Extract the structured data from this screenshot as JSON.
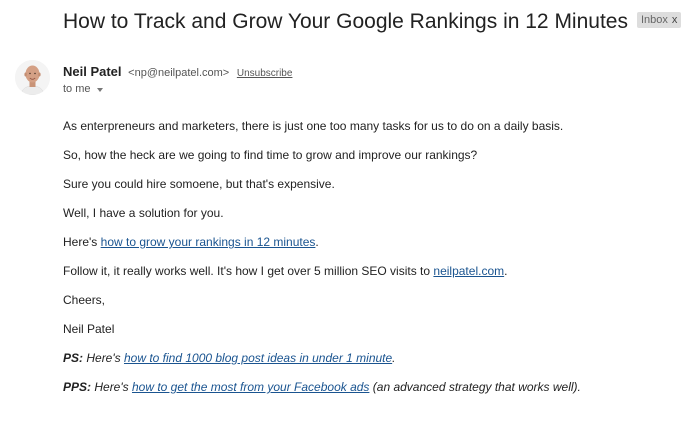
{
  "email": {
    "subject": "How to Track and Grow Your Google Rankings in 12 Minutes",
    "label": "Inbox",
    "label_remove": "x",
    "sender": {
      "name": "Neil Patel",
      "email": "<np@neilpatel.com>",
      "unsubscribe": "Unsubscribe"
    },
    "to": "to me"
  },
  "body": {
    "p1": "As enterpreneurs and marketers, there is just one too many tasks for us to do on a daily basis.",
    "p2": "So, how the heck are we going to find time to grow and improve our rankings?",
    "p3": "Sure you could hire somoene, but that's expensive.",
    "p4": "Well, I have a solution for you.",
    "p5_prefix": "Here's ",
    "p5_link": "how to grow your rankings in 12 minutes",
    "p5_suffix": ".",
    "p6_prefix": "Follow it, it really works well. It's how I get over 5 million SEO visits to ",
    "p6_link": "neilpatel.com",
    "p6_suffix": ".",
    "p7": "Cheers,",
    "p8": "Neil Patel",
    "ps_label": "PS:",
    "ps_prefix": " Here's ",
    "ps_link": "how to find 1000 blog post ideas in under 1 minute",
    "ps_suffix": ".",
    "pps_label": "PPS:",
    "pps_prefix": " Here's ",
    "pps_link": "how to get the most from your Facebook ads",
    "pps_suffix": " (an advanced strategy that works well)."
  },
  "icons": {
    "avatar": "sender-avatar",
    "caret": "chevron-down-icon"
  }
}
